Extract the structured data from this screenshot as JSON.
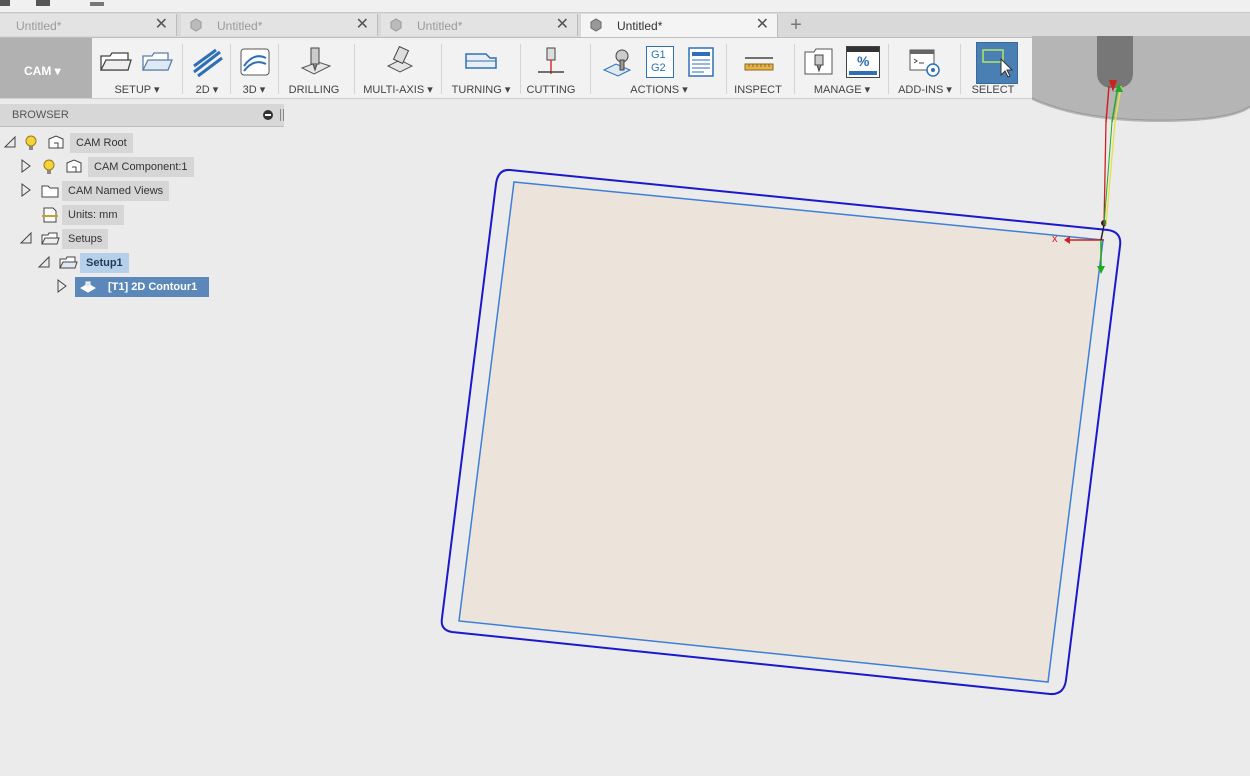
{
  "tabs": [
    {
      "label": "Untitled*",
      "close": "✕",
      "active": false
    },
    {
      "label": "Untitled*",
      "close": "✕",
      "active": false
    },
    {
      "label": "Untitled*",
      "close": "✕",
      "active": false
    },
    {
      "label": "Untitled*",
      "close": "✕",
      "active": true
    }
  ],
  "tab_add": "+",
  "toolbar": {
    "workspace": "CAM ▾",
    "groups": {
      "setup": "SETUP ▾",
      "twod": "2D ▾",
      "threed": "3D ▾",
      "drilling": "DRILLING",
      "multiaxis": "MULTI-AXIS ▾",
      "turning": "TURNING ▾",
      "cutting": "CUTTING",
      "actions": "ACTIONS ▾",
      "inspect": "INSPECT",
      "manage": "MANAGE ▾",
      "addins": "ADD-INS ▾",
      "select": "SELECT"
    },
    "actions_g1": "G1",
    "actions_g2": "G2",
    "manage_pct": "%"
  },
  "browser": {
    "title": "BROWSER",
    "items": [
      {
        "label": "CAM Root"
      },
      {
        "label": "CAM Component:1"
      },
      {
        "label": "CAM Named Views"
      },
      {
        "label": "Units: mm"
      },
      {
        "label": "Setups"
      },
      {
        "label": "Setup1"
      },
      {
        "label": "[T1] 2D Contour1"
      }
    ]
  },
  "colors": {
    "toolpath": "#1a1acc",
    "stock_edge": "#3d7fd6",
    "stock_fill": "#ece4db",
    "selection": "#5b88b8"
  }
}
